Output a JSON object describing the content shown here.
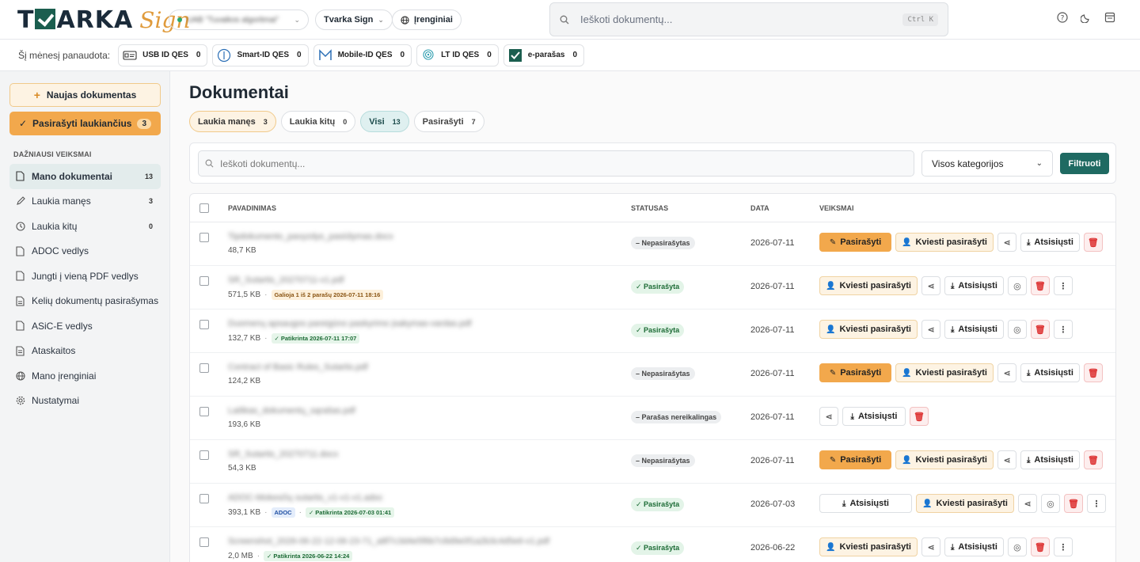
{
  "header": {
    "brand": "TVARKA",
    "brand_sign": "Sign",
    "org_name": "UAB \"Tuvaikos algoritmai\"",
    "workspace": "Tvarka Sign",
    "devices": "Įrenginiai",
    "search_placeholder": "Ieškoti dokumentų...",
    "search_shortcut": "Ctrl K"
  },
  "usage": {
    "lead": "Šį mėnesį panaudota:",
    "items": [
      {
        "label": "USB ID QES",
        "count": "0"
      },
      {
        "label": "Smart-ID QES",
        "count": "0"
      },
      {
        "label": "Mobile-ID QES",
        "count": "0"
      },
      {
        "label": "LT ID QES",
        "count": "0"
      },
      {
        "label": "e-parašas",
        "count": "0"
      }
    ]
  },
  "sidebar": {
    "new_doc": "Naujas dokumentas",
    "sign_waiting": "Pasirašyti laukiančius",
    "sign_waiting_count": "3",
    "section": "DAŽNIAUSI VEIKSMAI",
    "items": [
      {
        "label": "Mano dokumentai",
        "badge": "13"
      },
      {
        "label": "Laukia manęs",
        "badge": "3"
      },
      {
        "label": "Laukia kitų",
        "badge": "0"
      },
      {
        "label": "ADOC vedlys",
        "badge": ""
      },
      {
        "label": "Jungti į vieną PDF vedlys",
        "badge": ""
      },
      {
        "label": "Kelių dokumentų pasirašymas",
        "badge": ""
      },
      {
        "label": "ASiC-E vedlys",
        "badge": ""
      },
      {
        "label": "Ataskaitos",
        "badge": ""
      },
      {
        "label": "Mano įrenginiai",
        "badge": ""
      },
      {
        "label": "Nustatymai",
        "badge": ""
      }
    ]
  },
  "main": {
    "title": "Dokumentai",
    "tabs": [
      {
        "label": "Laukia manęs",
        "count": "3"
      },
      {
        "label": "Laukia kitų",
        "count": "0"
      },
      {
        "label": "Visi",
        "count": "13"
      },
      {
        "label": "Pasirašyti",
        "count": "7"
      }
    ],
    "filter_placeholder": "Ieškoti dokumentų...",
    "category": "Visos kategorijos",
    "filter_btn": "Filtruoti"
  },
  "table": {
    "headers": {
      "name": "PAVADINIMAS",
      "status": "STATUSAS",
      "date": "DATA",
      "actions": "VEIKSMAI"
    },
    "labels": {
      "sign": "Pasirašyti",
      "invite": "Kviesti pasirašyti",
      "download": "Atsisiųsti"
    },
    "rows": [
      {
        "name": "Tipdokumento_pavyzdys_pasiūlymas.docx",
        "size": "48,7 KB",
        "status": "Nepasirašytas",
        "date": "2026-07-11"
      },
      {
        "name": "SR_Sutartis_20270711-v1.pdf",
        "size": "571,5 KB",
        "badge": "Galioja 1 iš 2 parašų 2026-07-11 18:16",
        "status": "Pasirašyta",
        "date": "2026-07-11"
      },
      {
        "name": "Duomenų apsaugos pareigūno paskyrimo įsakymas-vardas.pdf",
        "size": "132,7 KB",
        "badge": "✓ Patikrinta 2026-07-11 17:07",
        "status": "Pasirašyta",
        "date": "2026-07-11"
      },
      {
        "name": "Contract of Basic Rules_Sutartis.pdf",
        "size": "124,2 KB",
        "status": "Nepasirašytas",
        "date": "2026-07-11"
      },
      {
        "name": "Laiškas_dokumentų_sąrašas.pdf",
        "size": "193,6 KB",
        "status": "Parašas nereikalingas",
        "date": "2026-07-11"
      },
      {
        "name": "SR_Sutartis_20270711.docx",
        "size": "54,3 KB",
        "status": "Nepasirašytas",
        "date": "2026-07-11"
      },
      {
        "name": "ADOC-Mokesčių sutartis_v1-v1-v1.adoc",
        "size": "393,1 KB",
        "badge1": "ADOC",
        "badge": "✓ Patikrinta 2026-07-03 01:41",
        "status": "Pasirašyta",
        "date": "2026-07-03"
      },
      {
        "name": "Screenshot_2026-06-22-12-06-23-71_a8f7c3d4e5f6b7c8d9e0f1a2b3c4d5e6-v1.pdf",
        "size": "2,0 MB",
        "badge": "✓ Patikrinta 2026-06-22 14:24",
        "status": "Pasirašyta",
        "date": "2026-06-22"
      }
    ]
  },
  "colors": {
    "accent": "#f2a84c",
    "primary": "#1f6a62",
    "sign_green": "#1b5e4f"
  }
}
